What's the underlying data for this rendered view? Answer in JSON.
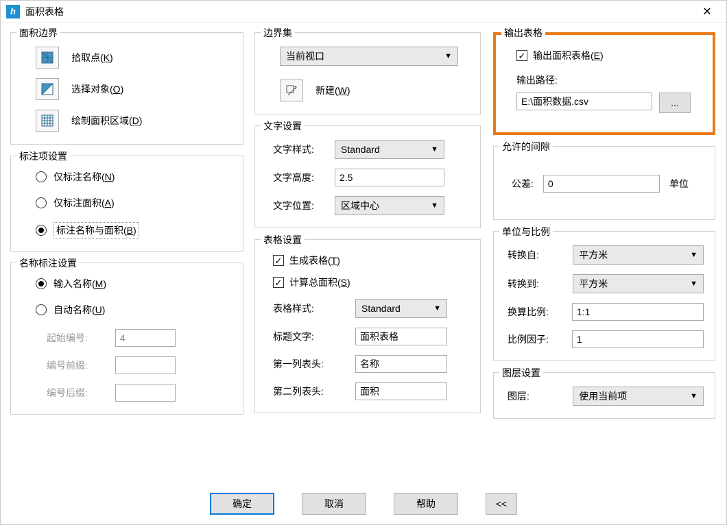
{
  "title": "面积表格",
  "area_boundary": {
    "legend": "面积边界",
    "pick_point": {
      "pre": "拾取点(",
      "key": "K",
      "post": ")"
    },
    "select_obj": {
      "pre": "选择对象(",
      "key": "O",
      "post": ")"
    },
    "draw_region": {
      "pre": "绘制面积区域(",
      "key": "D",
      "post": ")"
    }
  },
  "annot_settings": {
    "legend": "标注项设置",
    "name_only": {
      "pre": "仅标注名称(",
      "key": "N",
      "post": ")"
    },
    "area_only": {
      "pre": "仅标注面积(",
      "key": "A",
      "post": ")"
    },
    "both": {
      "pre": "标注名称与面积(",
      "key": "B",
      "post": ")"
    }
  },
  "name_annot": {
    "legend": "名称标注设置",
    "input_name": {
      "pre": "输入名称(",
      "key": "M",
      "post": ")"
    },
    "auto_name": {
      "pre": "自动名称(",
      "key": "U",
      "post": ")"
    },
    "start_no_label": "起始编号:",
    "start_no_value": "4",
    "prefix_label": "编号前缀:",
    "prefix_value": "",
    "suffix_label": "编号后缀:",
    "suffix_value": ""
  },
  "boundary_set": {
    "legend": "边界集",
    "viewport": "当前视口",
    "new_btn": {
      "pre": "新建(",
      "key": "W",
      "post": ")"
    }
  },
  "text_settings": {
    "legend": "文字设置",
    "style_label": "文字样式:",
    "style_value": "Standard",
    "height_label": "文字高度:",
    "height_value": "2.5",
    "pos_label": "文字位置:",
    "pos_value": "区域中心"
  },
  "table_settings": {
    "legend": "表格设置",
    "gen_table": {
      "pre": "生成表格(",
      "key": "T",
      "post": ")"
    },
    "calc_total": {
      "pre": "计算总面积(",
      "key": "S",
      "post": ")"
    },
    "style_label": "表格样式:",
    "style_value": "Standard",
    "title_label": "标题文字:",
    "title_value": "面积表格",
    "col1_label": "第一列表头:",
    "col1_value": "名称",
    "col2_label": "第二列表头:",
    "col2_value": "面积"
  },
  "output": {
    "legend": "输出表格",
    "export": {
      "pre": "输出面积表格(",
      "key": "E",
      "post": ")"
    },
    "path_label": "输出路径:",
    "path_value": "E:\\面积数据.csv",
    "browse": "..."
  },
  "gap": {
    "legend": "允许的间隙",
    "tol_label": "公差:",
    "tol_value": "0",
    "unit": "单位"
  },
  "units": {
    "legend": "单位与比例",
    "from_label": "转换自:",
    "from_value": "平方米",
    "to_label": "转换到:",
    "to_value": "平方米",
    "ratio_label": "换算比例:",
    "ratio_value": "1:1",
    "factor_label": "比例因子:",
    "factor_value": "1"
  },
  "layer": {
    "legend": "图层设置",
    "label": "图层:",
    "value": "使用当前项"
  },
  "buttons": {
    "ok": "确定",
    "cancel": "取消",
    "help": "帮助",
    "collapse": "<<"
  }
}
